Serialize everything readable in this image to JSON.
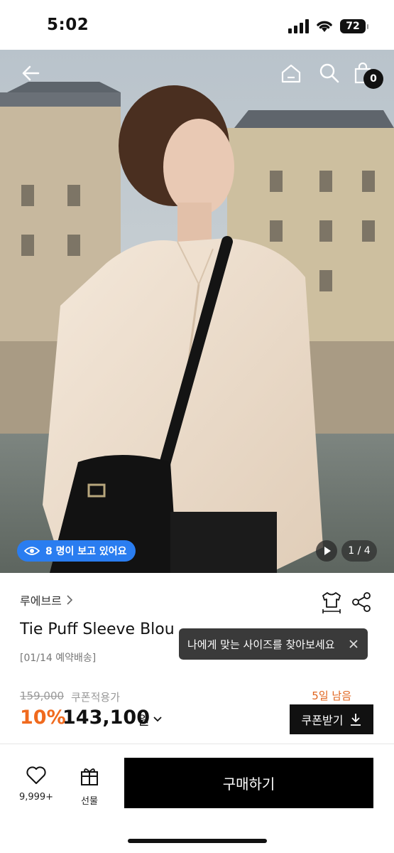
{
  "status_bar": {
    "time": "5:02",
    "battery": "72"
  },
  "hero": {
    "cart_count": "0",
    "viewers_text": "8 명이 보고 있어요",
    "page_indicator": "1 / 4"
  },
  "product": {
    "brand": "루에브르",
    "title": "Tie Puff Sleeve Blou",
    "delivery_note": "[01/14 예약배송]",
    "tooltip_text": "나에게 맞는 사이즈를 찾아보세요",
    "original_price": "159,000",
    "coupon_applied_label": "쿠폰적용가",
    "days_left": "5일 남음",
    "discount_percent": "10%",
    "sale_price": "143,100",
    "price_unit": "원",
    "coupon_button_label": "쿠폰받기"
  },
  "bottom_bar": {
    "like_count": "9,999+",
    "gift_label": "선물",
    "buy_label": "구매하기"
  },
  "colors": {
    "accent_blue": "#2a7df0",
    "discount_orange": "#f06a1e",
    "primary_black": "#000000"
  }
}
